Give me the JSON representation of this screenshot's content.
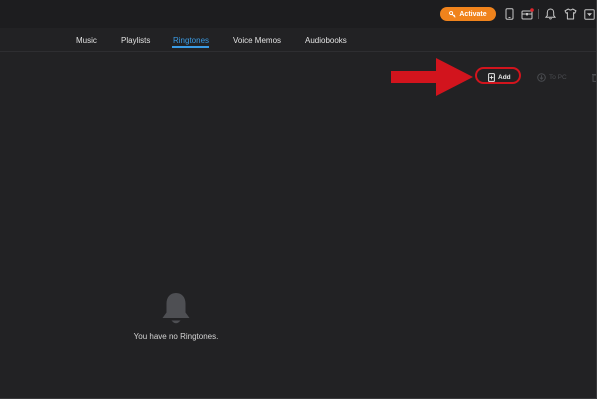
{
  "titlebar": {
    "activate_label": "Activate",
    "icons": [
      "device-icon",
      "toolbox-icon",
      "bell-icon",
      "shirt-icon",
      "menu-dropdown-icon"
    ]
  },
  "nav": {
    "tabs": [
      {
        "label": "Music",
        "active": false
      },
      {
        "label": "Playlists",
        "active": false
      },
      {
        "label": "Ringtones",
        "active": true
      },
      {
        "label": "Voice Memos",
        "active": false
      },
      {
        "label": "Audiobooks",
        "active": false
      }
    ]
  },
  "toolbar": {
    "add_label": "Add",
    "to_pc_label": "To PC"
  },
  "empty_state": {
    "icon": "bell-icon",
    "message": "You have no Ringtones."
  },
  "colors": {
    "background": "#222224",
    "titlebar": "#1d1d1f",
    "accent": "#3a9be4",
    "activate": "#f0831c",
    "annotation": "#d2141d"
  }
}
